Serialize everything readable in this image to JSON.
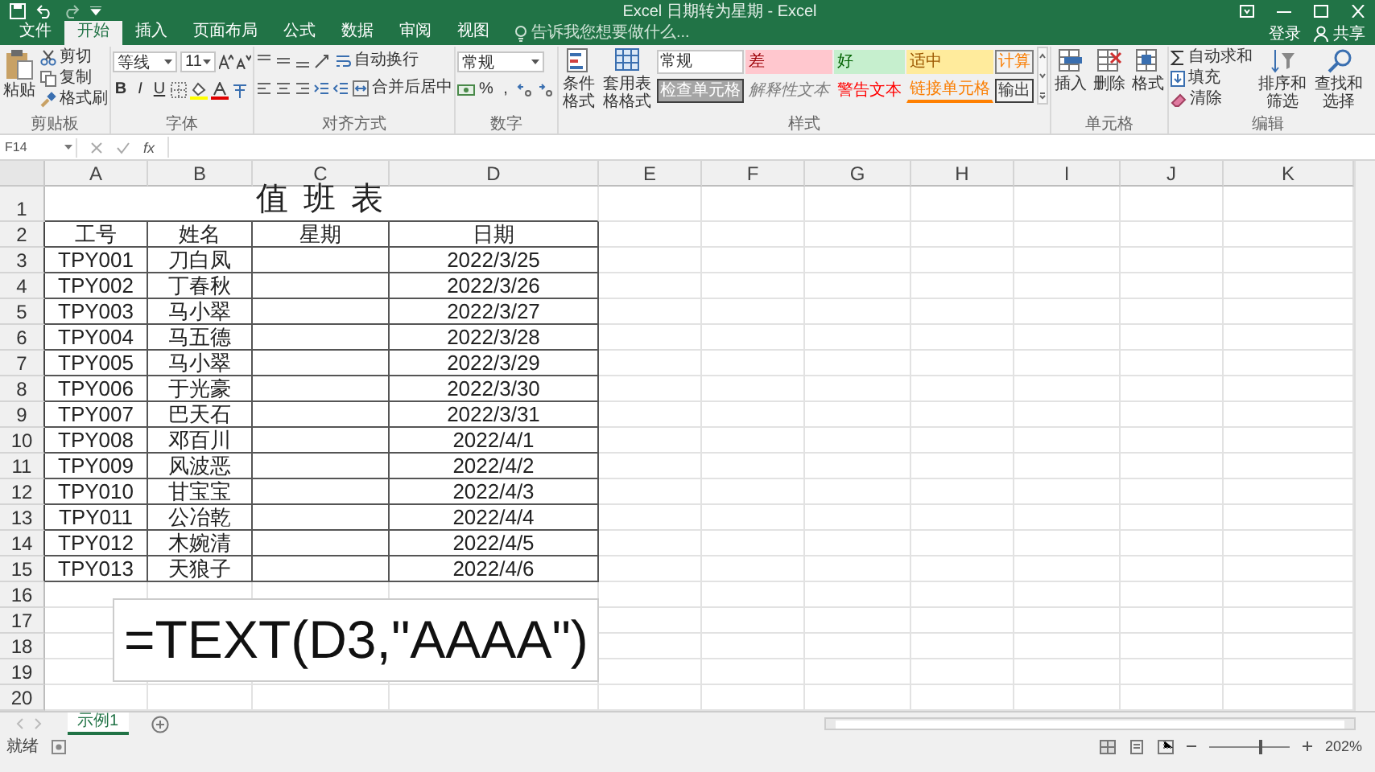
{
  "window": {
    "title": "Excel 日期转为星期 - Excel"
  },
  "menu_tabs": [
    {
      "label": "文件",
      "selected": false
    },
    {
      "label": "开始",
      "selected": true
    },
    {
      "label": "插入",
      "selected": false
    },
    {
      "label": "页面布局",
      "selected": false
    },
    {
      "label": "公式",
      "selected": false
    },
    {
      "label": "数据",
      "selected": false
    },
    {
      "label": "审阅",
      "selected": false
    },
    {
      "label": "视图",
      "selected": false
    }
  ],
  "tell_me": {
    "placeholder": "告诉我您想要做什么..."
  },
  "account": {
    "sign_in": "登录",
    "share": "共享"
  },
  "ribbon": {
    "clipboard": {
      "label": "剪贴板",
      "paste": "粘贴",
      "items": [
        "剪切",
        "复制",
        "格式刷"
      ]
    },
    "font": {
      "label": "字体",
      "font_name": "等线",
      "font_size": "11",
      "styles": [
        "B",
        "I",
        "U"
      ]
    },
    "alignment": {
      "label": "对齐方式",
      "wrap": "自动换行",
      "merge": "合并后居中"
    },
    "number": {
      "label": "数字",
      "format": "常规",
      "buttons": [
        "%",
        ","
      ]
    },
    "styles": {
      "label": "样式",
      "conditional": "条件格式",
      "table": "套用表格格式",
      "gallery": [
        {
          "text": "常规",
          "kind": "normal"
        },
        {
          "text": "差",
          "kind": "bad"
        },
        {
          "text": "好",
          "kind": "good"
        },
        {
          "text": "适中",
          "kind": "neutral"
        },
        {
          "text": "计算",
          "kind": "calculation"
        },
        {
          "text": "检查单元格",
          "kind": "check"
        },
        {
          "text": "解释性文本",
          "kind": "explanatory"
        },
        {
          "text": "警告文本",
          "kind": "warning"
        },
        {
          "text": "链接单元格",
          "kind": "linked"
        },
        {
          "text": "输出",
          "kind": "output"
        }
      ]
    },
    "cells": {
      "label": "单元格",
      "items": [
        "插入",
        "删除",
        "格式"
      ]
    },
    "editing": {
      "label": "编辑",
      "autosum": "自动求和",
      "fill": "填充",
      "clear": "清除",
      "sort": "排序和筛选",
      "find": "查找和选择"
    }
  },
  "formula_bar": {
    "name_box": "F14",
    "function_label": "fx"
  },
  "sheet": {
    "columns": [
      "A",
      "B",
      "C",
      "D",
      "E",
      "F",
      "G",
      "H",
      "I",
      "J",
      "K"
    ],
    "row_numbers": [
      "1",
      "2",
      "3",
      "4",
      "5",
      "6",
      "7",
      "8",
      "9",
      "10",
      "11",
      "12",
      "13",
      "14",
      "15",
      "16",
      "17",
      "18",
      "19",
      "20"
    ],
    "title": "值 班 表",
    "headers": [
      "工号",
      "姓名",
      "星期",
      "日期"
    ],
    "records": [
      {
        "id": "TPY001",
        "name": "刀白凤",
        "date": "2022/3/25"
      },
      {
        "id": "TPY002",
        "name": "丁春秋",
        "date": "2022/3/26"
      },
      {
        "id": "TPY003",
        "name": "马小翠",
        "date": "2022/3/27"
      },
      {
        "id": "TPY004",
        "name": "马五德",
        "date": "2022/3/28"
      },
      {
        "id": "TPY005",
        "name": "马小翠",
        "date": "2022/3/29"
      },
      {
        "id": "TPY006",
        "name": "于光豪",
        "date": "2022/3/30"
      },
      {
        "id": "TPY007",
        "name": "巴天石",
        "date": "2022/3/31"
      },
      {
        "id": "TPY008",
        "name": "邓百川",
        "date": "2022/4/1"
      },
      {
        "id": "TPY009",
        "name": "风波恶",
        "date": "2022/4/2"
      },
      {
        "id": "TPY010",
        "name": "甘宝宝",
        "date": "2022/4/3"
      },
      {
        "id": "TPY011",
        "name": "公冶乾",
        "date": "2022/4/4"
      },
      {
        "id": "TPY012",
        "name": "木婉清",
        "date": "2022/4/5"
      },
      {
        "id": "TPY013",
        "name": "天狼子",
        "date": "2022/4/6"
      }
    ]
  },
  "overlay": {
    "formula": "=TEXT(D3,\"AAAA\")"
  },
  "sheet_tabs": [
    {
      "label": "示例1",
      "selected": true
    }
  ],
  "status_bar": {
    "status": "就绪",
    "zoom": {
      "label": "202%",
      "level": 0.62
    }
  }
}
